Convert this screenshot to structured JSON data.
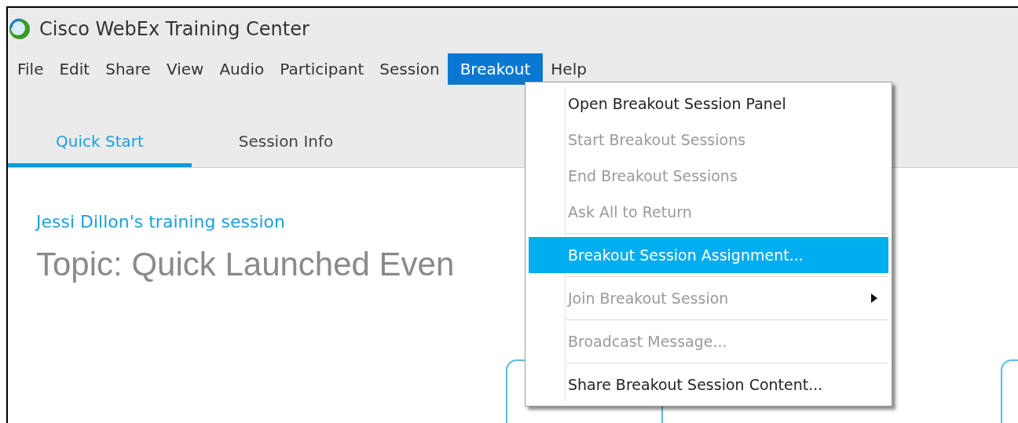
{
  "window": {
    "title": "Cisco WebEx Training Center"
  },
  "menu_bar": [
    {
      "label": "File",
      "selected": false
    },
    {
      "label": "Edit",
      "selected": false
    },
    {
      "label": "Share",
      "selected": false
    },
    {
      "label": "View",
      "selected": false
    },
    {
      "label": "Audio",
      "selected": false
    },
    {
      "label": "Participant",
      "selected": false
    },
    {
      "label": "Session",
      "selected": false
    },
    {
      "label": "Breakout",
      "selected": true
    },
    {
      "label": "Help",
      "selected": false
    }
  ],
  "tabs": [
    {
      "label": "Quick Start",
      "selected": true
    },
    {
      "label": "Session Info",
      "selected": false
    }
  ],
  "content": {
    "host_line": "Jessi Dillon's training session",
    "topic": "Topic: Quick Launched Even"
  },
  "breakout_menu": [
    {
      "kind": "item",
      "label": "Open Breakout Session Panel",
      "disabled": false,
      "selected": false,
      "submenu": false
    },
    {
      "kind": "item",
      "label": "Start Breakout Sessions",
      "disabled": true,
      "selected": false,
      "submenu": false
    },
    {
      "kind": "item",
      "label": "End Breakout Sessions",
      "disabled": true,
      "selected": false,
      "submenu": false
    },
    {
      "kind": "item",
      "label": "Ask All to Return",
      "disabled": true,
      "selected": false,
      "submenu": false
    },
    {
      "kind": "separator"
    },
    {
      "kind": "item",
      "label": "Breakout Session Assignment...",
      "disabled": false,
      "selected": true,
      "submenu": false
    },
    {
      "kind": "separator"
    },
    {
      "kind": "item",
      "label": "Join Breakout Session",
      "disabled": true,
      "selected": false,
      "submenu": true
    },
    {
      "kind": "separator"
    },
    {
      "kind": "item",
      "label": "Broadcast Message...",
      "disabled": true,
      "selected": false,
      "submenu": false
    },
    {
      "kind": "separator"
    },
    {
      "kind": "item",
      "label": "Share Breakout Session Content...",
      "disabled": false,
      "selected": false,
      "submenu": false
    }
  ]
}
